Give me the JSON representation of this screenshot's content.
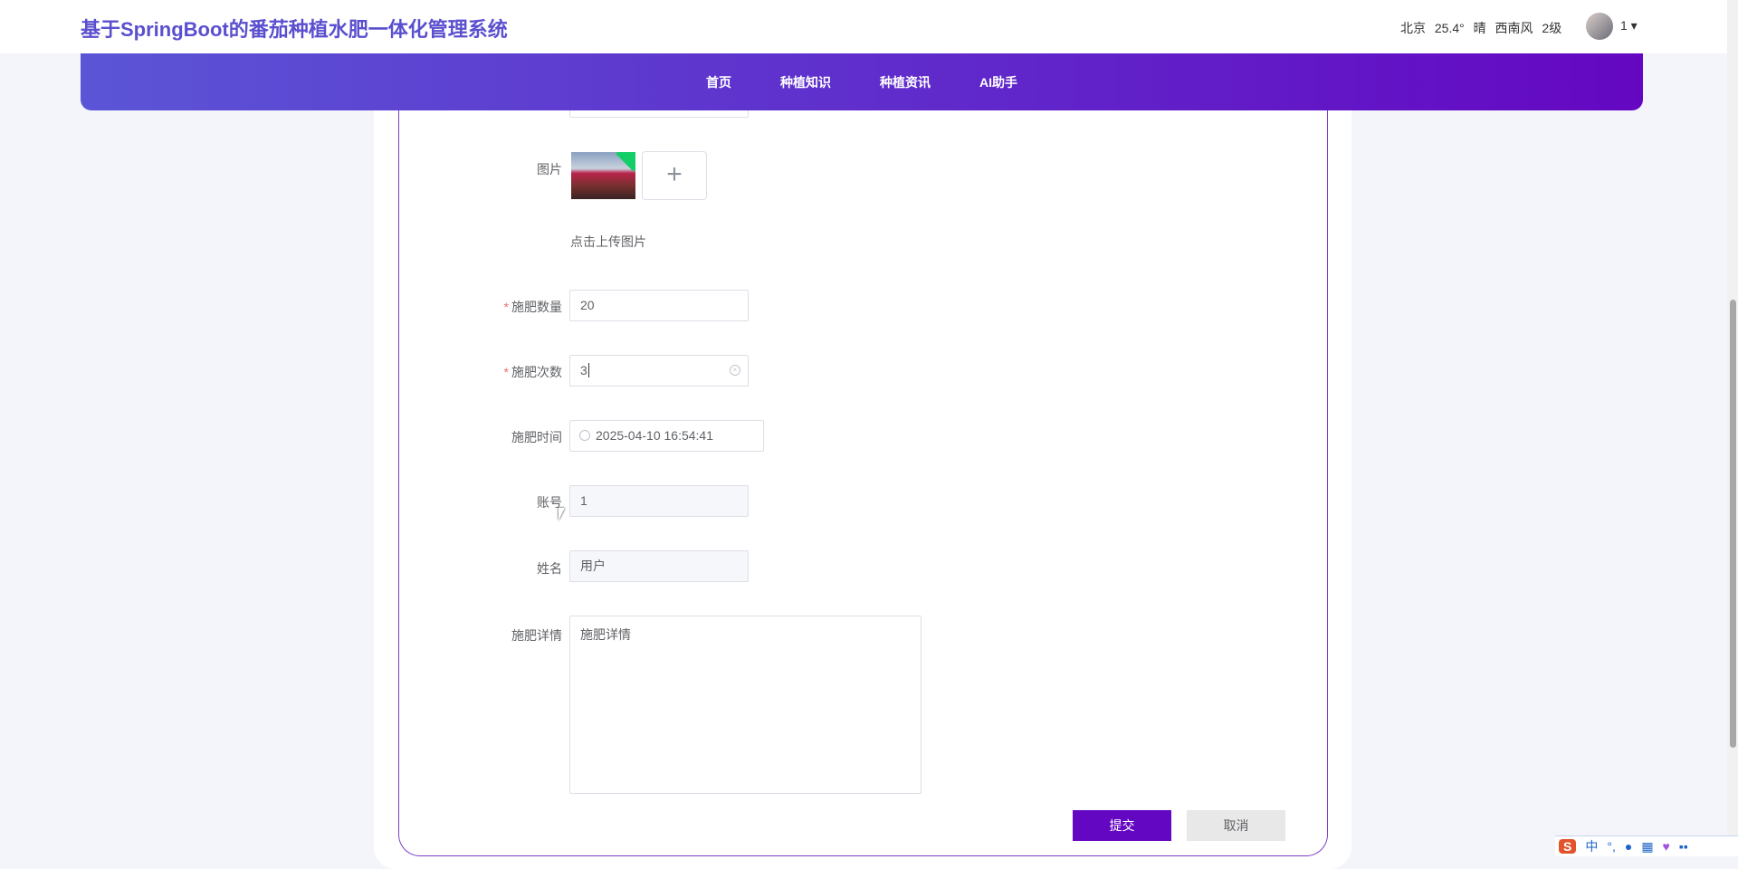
{
  "header": {
    "title": "基于SpringBoot的番茄种植水肥一体化管理系统",
    "weather": "北京 25.4° 晴 西南风 2级",
    "user": "1 ▾"
  },
  "nav": [
    "首页",
    "种植知识",
    "种植资讯",
    "AI助手"
  ],
  "form": {
    "image_label": "图片",
    "upload_hint": "点击上传图片",
    "upload_plus": "+",
    "amount_label": "施肥数量",
    "amount_value": "20",
    "count_label": "施肥次数",
    "count_value": "3",
    "time_label": "施肥时间",
    "time_value": "2025-04-10 16:54:41",
    "account_label": "账号",
    "account_value": "1",
    "name_label": "姓名",
    "name_value": "用户",
    "detail_label": "施肥详情",
    "detail_value": "施肥详情",
    "required_mark": "*",
    "submit": "提交",
    "cancel": "取消"
  },
  "ime": {
    "logo": "S",
    "mode": "中",
    "punct": "°,"
  },
  "colors": {
    "accent": "#6407c2",
    "title": "#5a4fcf"
  }
}
